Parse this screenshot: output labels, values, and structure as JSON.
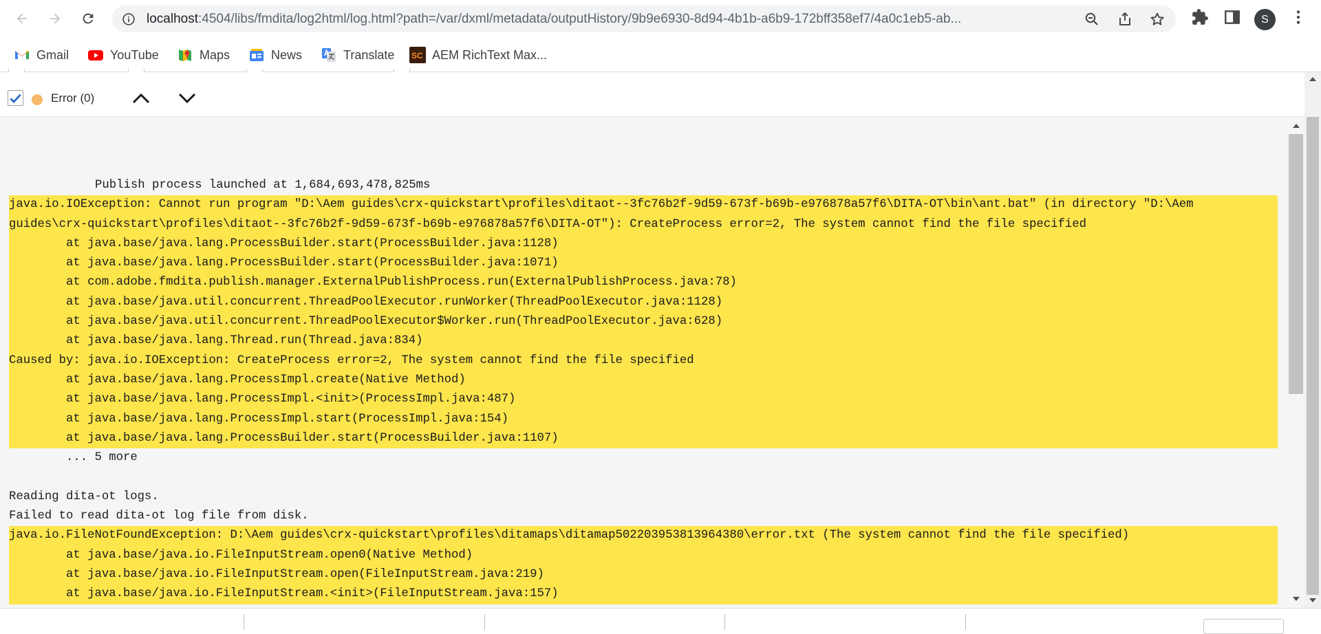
{
  "browser": {
    "url_host": "localhost",
    "url_path": ":4504/libs/fmdita/log2html/log.html?path=/var/dxml/metadata/outputHistory/9b9e6930-8d94-4b1b-a6b9-172bff358ef7/4a0c1eb5-ab...",
    "avatar_letter": "S",
    "icons": [
      "back-arrow-icon",
      "forward-arrow-icon",
      "reload-icon",
      "info-icon",
      "zoom-out-icon",
      "share-icon",
      "star-icon",
      "extensions-icon",
      "side-panel-icon",
      "more-vert-icon"
    ]
  },
  "bookmarks": [
    {
      "label": "Gmail",
      "icon": "gmail-icon"
    },
    {
      "label": "YouTube",
      "icon": "youtube-icon"
    },
    {
      "label": "Maps",
      "icon": "maps-icon"
    },
    {
      "label": "News",
      "icon": "news-icon"
    },
    {
      "label": "Translate",
      "icon": "translate-icon"
    },
    {
      "label": "AEM RichText Max...",
      "icon": "sc-icon"
    }
  ],
  "toolbar": {
    "filter_label": "Error (0)",
    "filter_checked": true,
    "dot_color": "#f6b96a"
  },
  "colors": {
    "highlight": "#fde54c",
    "log_bg": "#f5f5f5"
  },
  "log": {
    "launch": "Publish process launched at 1,684,693,478,825ms",
    "block1": [
      "java.io.IOException: Cannot run program \"D:\\Aem guides\\crx-quickstart\\profiles\\ditaot--3fc76b2f-9d59-673f-b69b-e976878a57f6\\DITA-OT\\bin\\ant.bat\" (in directory \"D:\\Aem",
      "guides\\crx-quickstart\\profiles\\ditaot--3fc76b2f-9d59-673f-b69b-e976878a57f6\\DITA-OT\"): CreateProcess error=2, The system cannot find the file specified",
      "at java.base/java.lang.ProcessBuilder.start(ProcessBuilder.java:1128)",
      "at java.base/java.lang.ProcessBuilder.start(ProcessBuilder.java:1071)",
      "at com.adobe.fmdita.publish.manager.ExternalPublishProcess.run(ExternalPublishProcess.java:78)",
      "at java.base/java.util.concurrent.ThreadPoolExecutor.runWorker(ThreadPoolExecutor.java:1128)",
      "at java.base/java.util.concurrent.ThreadPoolExecutor$Worker.run(ThreadPoolExecutor.java:628)",
      "at java.base/java.lang.Thread.run(Thread.java:834)",
      "Caused by: java.io.IOException: CreateProcess error=2, The system cannot find the file specified",
      "at java.base/java.lang.ProcessImpl.create(Native Method)",
      "at java.base/java.lang.ProcessImpl.<init>(ProcessImpl.java:487)",
      "at java.base/java.lang.ProcessImpl.start(ProcessImpl.java:154)",
      "at java.base/java.lang.ProcessBuilder.start(ProcessBuilder.java:1107)"
    ],
    "more": "... 5 more",
    "reading": "Reading dita-ot logs.",
    "failed": "Failed to read dita-ot log file from disk.",
    "block2": [
      "java.io.FileNotFoundException: D:\\Aem guides\\crx-quickstart\\profiles\\ditamaps\\ditamap502203953813964380\\error.txt (The system cannot find the file specified)",
      "at java.base/java.io.FileInputStream.open0(Native Method)",
      "at java.base/java.io.FileInputStream.open(FileInputStream.java:219)",
      "at java.base/java.io.FileInputStream.<init>(FileInputStream.java:157)"
    ]
  }
}
